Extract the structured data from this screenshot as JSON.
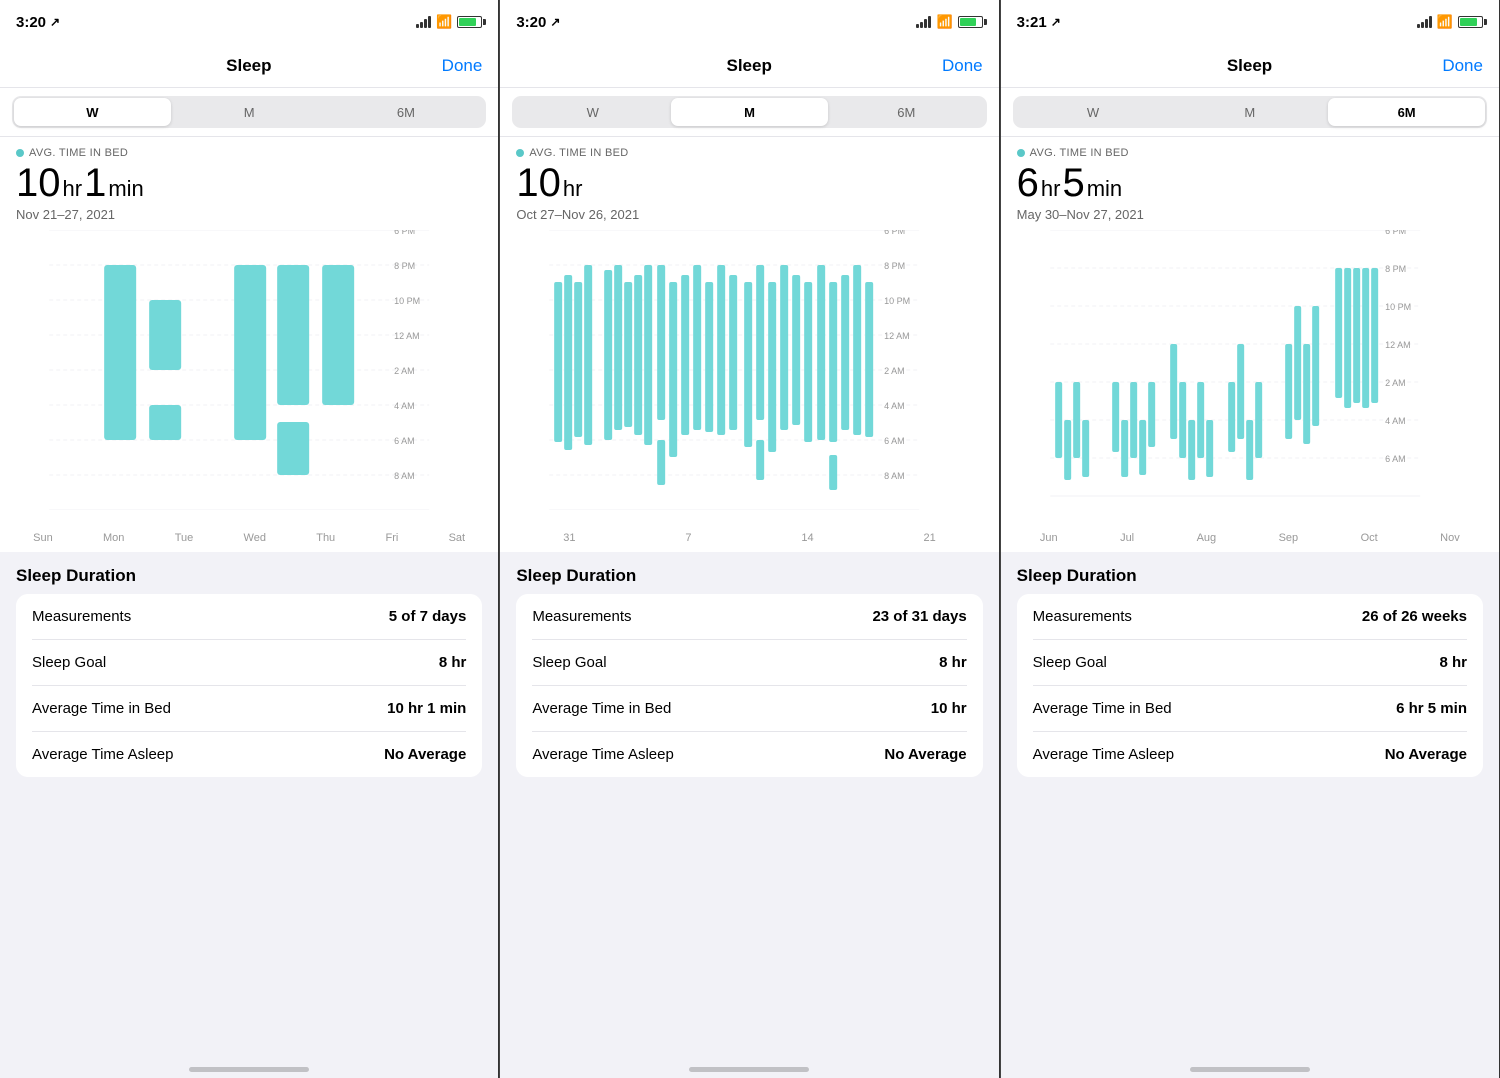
{
  "panels": [
    {
      "id": "panel-week",
      "status": {
        "time": "3:20",
        "location": true
      },
      "nav": {
        "title": "Sleep",
        "done": "Done"
      },
      "segments": [
        "W",
        "M",
        "6M"
      ],
      "active_segment": 0,
      "avg_label": "AVG. TIME IN BED",
      "main_value_hours": "10",
      "main_value_hr_unit": "hr",
      "main_value_mins": "1",
      "main_value_min_unit": "min",
      "date_range": "Nov 21–27, 2021",
      "chart_y_labels": [
        "6 PM",
        "8 PM",
        "10 PM",
        "12 AM",
        "2 AM",
        "4 AM",
        "6 AM",
        "8 AM"
      ],
      "chart_x_labels": [
        "Sun",
        "Mon",
        "Tue",
        "Wed",
        "Thu",
        "Fri",
        "Sat"
      ],
      "section_title": "Sleep Duration",
      "cards": [
        {
          "label": "Measurements",
          "value": "5 of 7 days"
        },
        {
          "label": "Sleep Goal",
          "value": "8 hr"
        },
        {
          "label": "Average Time in Bed",
          "value": "10 hr 1 min"
        },
        {
          "label": "Average Time Asleep",
          "value": "No Average"
        }
      ]
    },
    {
      "id": "panel-month",
      "status": {
        "time": "3:20",
        "location": true
      },
      "nav": {
        "title": "Sleep",
        "done": "Done"
      },
      "segments": [
        "W",
        "M",
        "6M"
      ],
      "active_segment": 1,
      "avg_label": "AVG. TIME IN BED",
      "main_value_hours": "10",
      "main_value_hr_unit": "hr",
      "main_value_mins": "",
      "main_value_min_unit": "",
      "date_range": "Oct 27–Nov 26, 2021",
      "chart_y_labels": [
        "6 PM",
        "8 PM",
        "10 PM",
        "12 AM",
        "2 AM",
        "4 AM",
        "6 AM",
        "8 AM"
      ],
      "chart_x_labels": [
        "31",
        "7",
        "14",
        "21"
      ],
      "section_title": "Sleep Duration",
      "cards": [
        {
          "label": "Measurements",
          "value": "23 of 31 days"
        },
        {
          "label": "Sleep Goal",
          "value": "8 hr"
        },
        {
          "label": "Average Time in Bed",
          "value": "10 hr"
        },
        {
          "label": "Average Time Asleep",
          "value": "No Average"
        }
      ]
    },
    {
      "id": "panel-6month",
      "status": {
        "time": "3:21",
        "location": true
      },
      "nav": {
        "title": "Sleep",
        "done": "Done"
      },
      "segments": [
        "W",
        "M",
        "6M"
      ],
      "active_segment": 2,
      "avg_label": "AVG. TIME IN BED",
      "main_value_hours": "6",
      "main_value_hr_unit": "hr",
      "main_value_mins": "5",
      "main_value_min_unit": "min",
      "date_range": "May 30–Nov 27, 2021",
      "chart_y_labels": [
        "6 PM",
        "8 PM",
        "10 PM",
        "12 AM",
        "2 AM",
        "4 AM",
        "6 AM"
      ],
      "chart_x_labels": [
        "Jun",
        "Jul",
        "Aug",
        "Sep",
        "Oct",
        "Nov"
      ],
      "section_title": "Sleep Duration",
      "cards": [
        {
          "label": "Measurements",
          "value": "26 of 26 weeks"
        },
        {
          "label": "Sleep Goal",
          "value": "8 hr"
        },
        {
          "label": "Average Time in Bed",
          "value": "6 hr 5 min"
        },
        {
          "label": "Average Time Asleep",
          "value": "No Average"
        }
      ]
    }
  ]
}
